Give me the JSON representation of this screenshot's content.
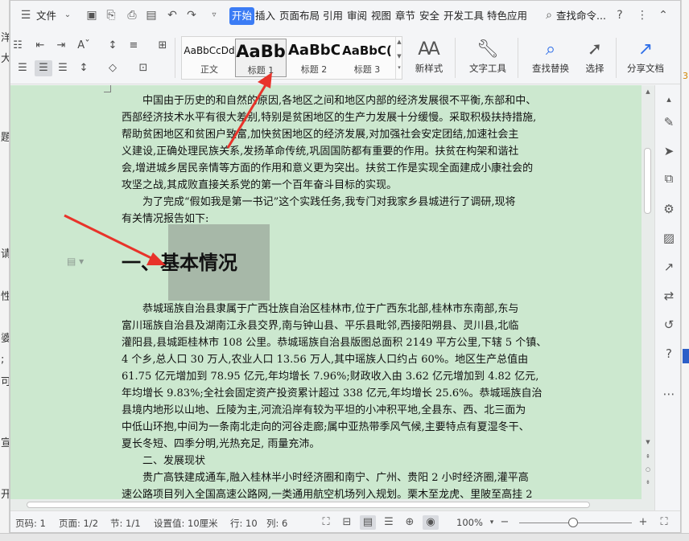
{
  "menu": {
    "file_label": "文件",
    "tabs": [
      {
        "label": "开始",
        "active": true
      },
      {
        "label": "插入"
      },
      {
        "label": "页面布局"
      },
      {
        "label": "引用"
      },
      {
        "label": "审阅"
      },
      {
        "label": "视图"
      },
      {
        "label": "章节"
      },
      {
        "label": "安全"
      },
      {
        "label": "开发工具"
      },
      {
        "label": "特色应用"
      }
    ],
    "search_label": "查找命令..."
  },
  "ribbon": {
    "styles": [
      {
        "preview": "AaBbCcDd",
        "label": "正文"
      },
      {
        "preview": "AaBb",
        "label": "标题 1",
        "selected": true
      },
      {
        "preview": "AaBbC(",
        "label": "标题 2"
      },
      {
        "preview": "AaBbC(",
        "label": "标题 3"
      }
    ],
    "new_style": "新样式",
    "text_tools": "文字工具",
    "find_replace": "查找替换",
    "select": "选择",
    "share": "分享文档"
  },
  "doc": {
    "p1": [
      "中国由于历史的和自然的原因,各地区之间和地区内部的经济发展很不平衡,东部和中、",
      "西部经济技术水平有很大差别,特别是贫困地区的生产力发展十分缓慢。采取积极扶持措施,",
      "帮助贫困地区和贫困户致富,加快贫困地区的经济发展,对加强社会安定团结,加速社会主",
      "义建设,正确处理民族关系,发扬革命传统,巩固国防都有重要的作用。扶贫在构架和谐社",
      "会,增进城乡居民亲情等方面的作用和意义更为突出。扶贫工作是实现全面建成小康社会的",
      "攻坚之战,其成败直接关系党的第一个百年奋斗目标的实现。"
    ],
    "p2": [
      "为了完成“假如我是第一书记”这个实践任务,我专门对我家乡县城进行了调研,现将",
      "有关情况报告如下:"
    ],
    "heading": "一、基本情况",
    "p3": [
      "恭城瑶族自治县隶属于广西壮族自治区桂林市,位于广西东北部,桂林市东南部,东与",
      "富川瑶族自治县及湖南江永县交界,南与钟山县、平乐县毗邻,西接阳朔县、灵川县,北临",
      "灌阳县,县城距桂林市 108 公里。恭城瑶族自治县版图总面积 2149 平方公里,下辖 5 个镇、",
      "4 个乡,总人口 30 万人,农业人口 13.56 万人,其中瑶族人口约占 60%。地区生产总值由",
      "61.75 亿元增加到 78.95 亿元,年均增长 7.96%;财政收入由 3.62 亿元增加到 4.82 亿元,",
      "年均增长 9.83%;全社会固定资产投资累计超过 338 亿元,年均增长 25.6%。恭城瑶族自治",
      "县境内地形以山地、丘陵为主,河流沿岸有较为平坦的小冲积平地,全县东、西、北三面为",
      "中低山环抱,中间为一条南北走向的河谷走廊;属中亚热带季风气候,主要特点有夏湿冬干、",
      "夏长冬短、四季分明,光热充足, 雨量充沛。"
    ],
    "sub_heading": "二、发展现状",
    "p4": [
      "贵广高铁建成通车,融入桂林半小时经济圈和南宁、广州、贵阳 2 小时经济圈,灌平高",
      "速公路项目列入全国高速公路网,一类通用航空机场列入规划。栗木至龙虎、里陂至高挂 2"
    ]
  },
  "status": {
    "page_code": "页码: 1",
    "pages": "页面: 1/2",
    "section": "节: 1/1",
    "setting": "设置值: 10厘米",
    "row": "行: 10",
    "col": "列: 6",
    "zoom": "100%"
  },
  "background_right": "3",
  "background_left_chars": [
    "洋",
    "大",
    "題",
    "请",
    "性",
    "婆",
    ";",
    "可",
    "宣",
    "开"
  ]
}
